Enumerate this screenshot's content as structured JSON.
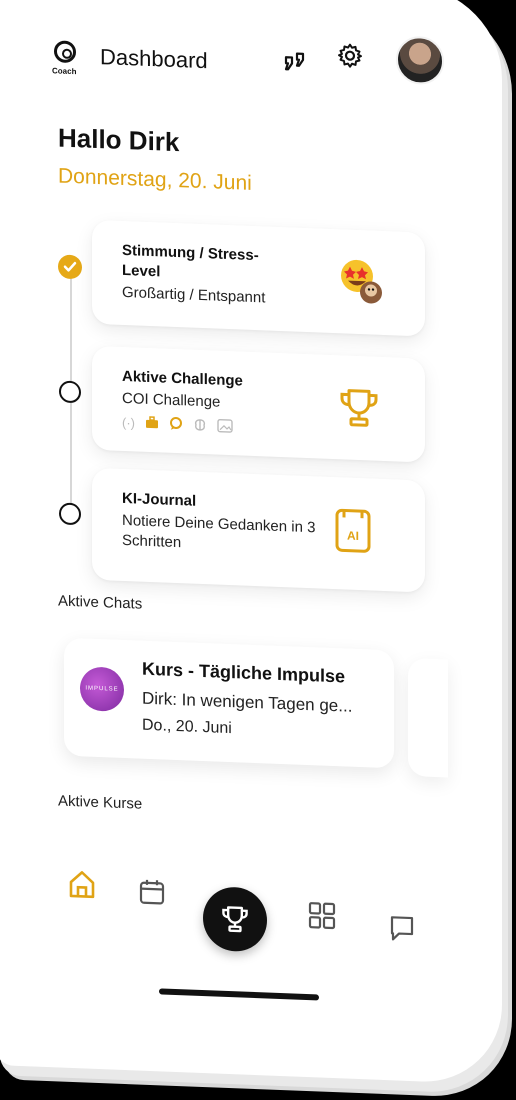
{
  "header": {
    "logo_text": "Coach",
    "title": "Dashboard",
    "icons": [
      "quote-icon",
      "gear-icon"
    ]
  },
  "greeting": "Hallo Dirk",
  "date": "Donnerstag, 20. Juni",
  "timeline": [
    {
      "status": "done",
      "title_line1": "Stimmung / Stress-",
      "title_line2": "Level",
      "subtitle": "Großartig / Entspannt",
      "icon": "emoji-icon"
    },
    {
      "status": "open",
      "title": "Aktive Challenge",
      "subtitle": "COI Challenge",
      "icon": "trophy-icon",
      "mini_icons": [
        "signal-icon",
        "briefcase-icon",
        "chat-icon",
        "brain-icon",
        "image-icon"
      ]
    },
    {
      "status": "open",
      "title": "KI-Journal",
      "subtitle_line1": "Notiere Deine Gedanken in 3",
      "subtitle_line2": "Schritten",
      "icon": "ai-journal-icon"
    }
  ],
  "sections": {
    "active_chats": "Aktive Chats",
    "active_courses": "Aktive Kurse"
  },
  "chat": {
    "avatar_text": "IMPULSE",
    "title": "Kurs - Tägliche Impulse",
    "message": "Dirk: In wenigen Tagen ge...",
    "date": "Do., 20. Juni"
  },
  "nav": [
    "home-icon",
    "calendar-icon",
    "trophy-icon",
    "grid-icon",
    "message-icon"
  ],
  "colors": {
    "accent": "#e0a315",
    "dark": "#111111"
  }
}
